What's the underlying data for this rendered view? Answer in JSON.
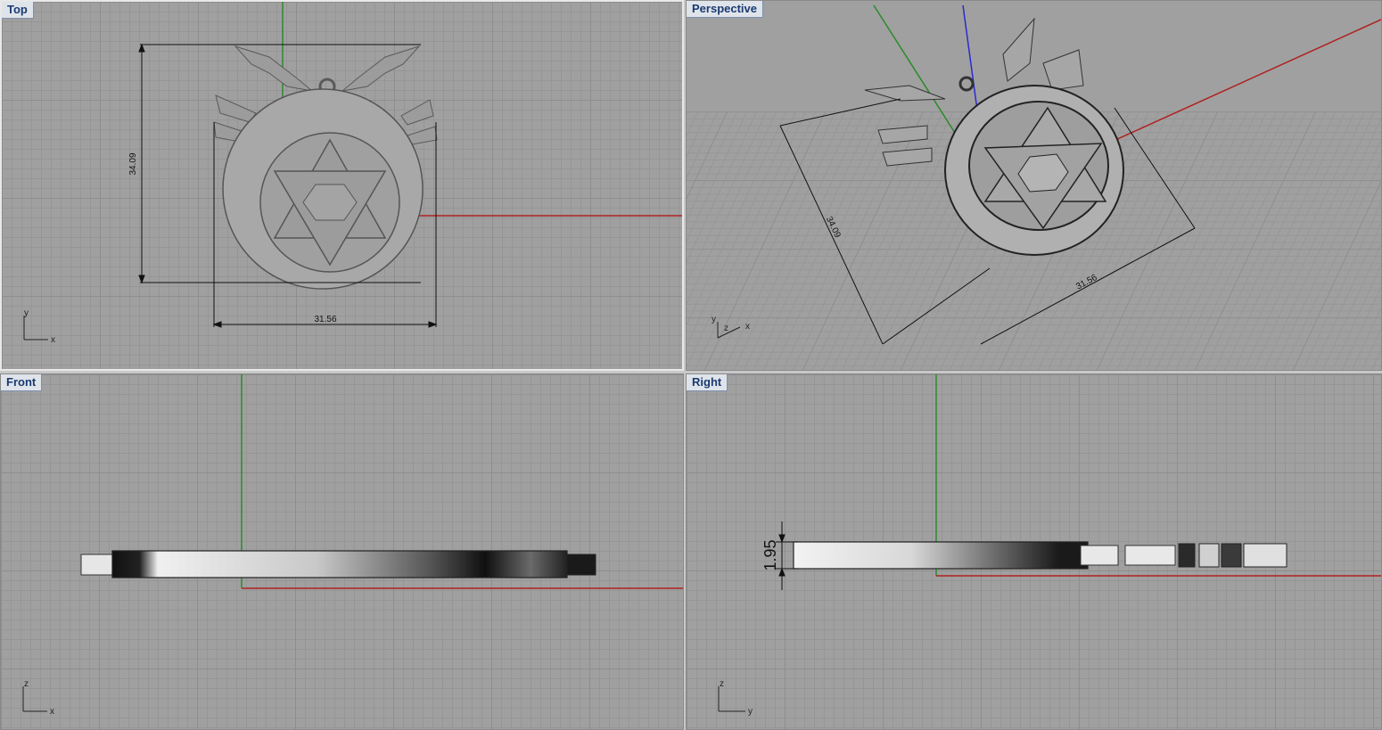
{
  "viewports": {
    "top": {
      "title": "Top",
      "dim_height": "34.09",
      "dim_width": "31.56",
      "axis_v": "y",
      "axis_h": "x"
    },
    "perspective": {
      "title": "Perspective",
      "dim_height": "34.09",
      "dim_width": "31.56",
      "axis_v": "y",
      "axis_z": "z",
      "axis_h": "x"
    },
    "front": {
      "title": "Front",
      "axis_v": "z",
      "axis_h": "x"
    },
    "right": {
      "title": "Right",
      "dim_thickness": "1.95",
      "axis_v": "z",
      "axis_h": "y"
    }
  },
  "colors": {
    "x_axis": "#b02020",
    "y_axis": "#2a8a2a",
    "z_axis": "#2a2ad0",
    "grid_bg": "#a0a0a0",
    "model": "#9a9a9a"
  },
  "icons": [
    "pendant-model",
    "dimension-line",
    "axis-indicator"
  ]
}
